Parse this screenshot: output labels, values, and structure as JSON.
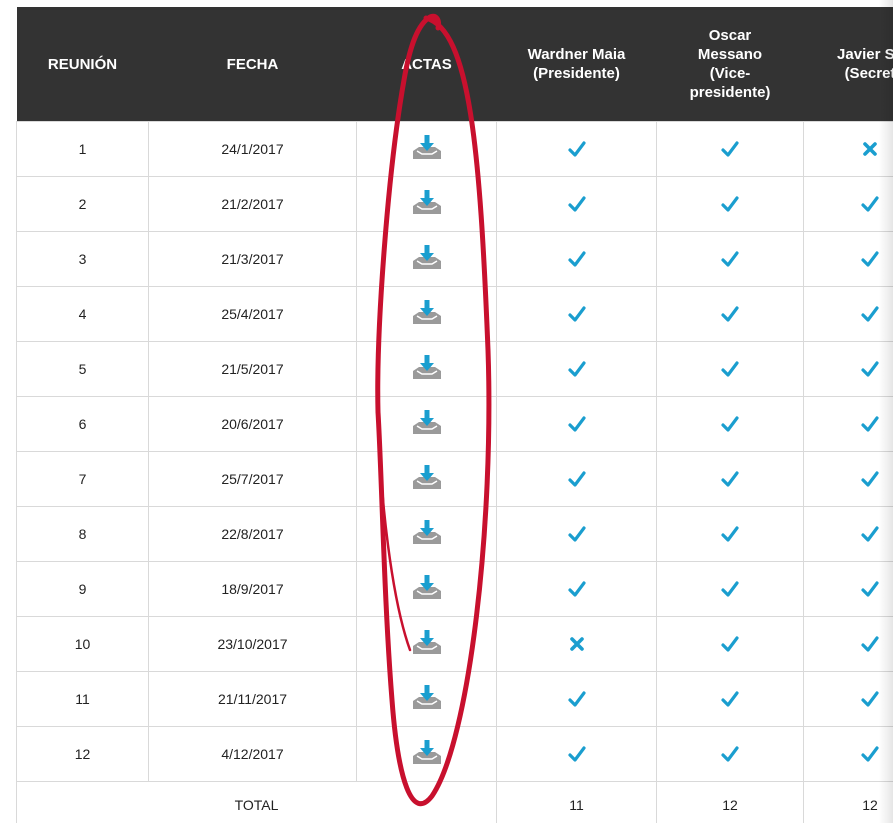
{
  "table": {
    "headers": [
      {
        "key": "reunion",
        "lines": [
          "REUNIÓN"
        ]
      },
      {
        "key": "fecha",
        "lines": [
          "FECHA"
        ]
      },
      {
        "key": "actas",
        "lines": [
          "ACTAS"
        ]
      },
      {
        "key": "member1",
        "lines": [
          "Wardner Maia",
          "(Presidente)"
        ]
      },
      {
        "key": "member2",
        "lines": [
          "Oscar",
          "Messano",
          "(Vice-",
          "presidente)"
        ]
      },
      {
        "key": "member3",
        "lines": [
          "Javier Sa",
          "(Secret"
        ]
      }
    ],
    "rows": [
      {
        "reunion": "1",
        "fecha": "24/1/2017",
        "attendance": [
          true,
          true,
          false
        ]
      },
      {
        "reunion": "2",
        "fecha": "21/2/2017",
        "attendance": [
          true,
          true,
          true
        ]
      },
      {
        "reunion": "3",
        "fecha": "21/3/2017",
        "attendance": [
          true,
          true,
          true
        ]
      },
      {
        "reunion": "4",
        "fecha": "25/4/2017",
        "attendance": [
          true,
          true,
          true
        ]
      },
      {
        "reunion": "5",
        "fecha": "21/5/2017",
        "attendance": [
          true,
          true,
          true
        ]
      },
      {
        "reunion": "6",
        "fecha": "20/6/2017",
        "attendance": [
          true,
          true,
          true
        ]
      },
      {
        "reunion": "7",
        "fecha": "25/7/2017",
        "attendance": [
          true,
          true,
          true
        ]
      },
      {
        "reunion": "8",
        "fecha": "22/8/2017",
        "attendance": [
          true,
          true,
          true
        ]
      },
      {
        "reunion": "9",
        "fecha": "18/9/2017",
        "attendance": [
          true,
          true,
          true
        ]
      },
      {
        "reunion": "10",
        "fecha": "23/10/2017",
        "attendance": [
          false,
          true,
          true
        ]
      },
      {
        "reunion": "11",
        "fecha": "21/11/2017",
        "attendance": [
          true,
          true,
          true
        ]
      },
      {
        "reunion": "12",
        "fecha": "4/12/2017",
        "attendance": [
          true,
          true,
          true
        ]
      }
    ],
    "footer": {
      "label": "TOTAL",
      "totals": [
        "11",
        "12",
        "12"
      ]
    }
  },
  "icons": {
    "present": "check-icon",
    "absent": "cross-icon",
    "actas": "download-icon"
  },
  "colors": {
    "header_bg": "#333333",
    "header_text": "#ffffff",
    "accent": "#1a9ecf",
    "tray": "#9a9a9a",
    "annotation": "#c8102e"
  }
}
